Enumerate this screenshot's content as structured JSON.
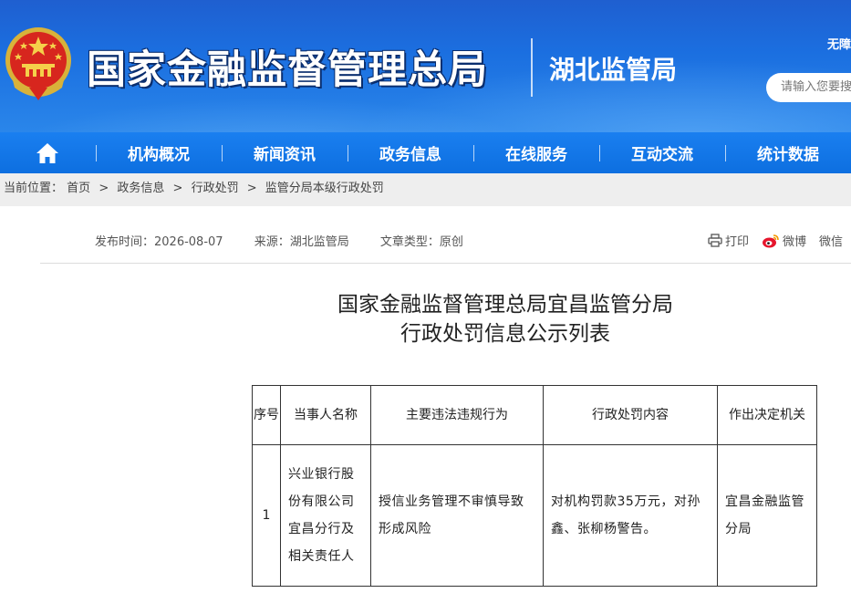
{
  "header": {
    "site_title": "国家金融监督管理总局",
    "sub_title": "湖北监管局",
    "access_link": "无障",
    "search_placeholder": "请输入您要搜"
  },
  "nav": {
    "home_icon": "home-icon",
    "items": [
      "机构概况",
      "新闻资讯",
      "政务信息",
      "在线服务",
      "互动交流",
      "统计数据"
    ]
  },
  "breadcrumb": {
    "label": "当前位置：",
    "items": [
      "首页",
      "政务信息",
      "行政处罚",
      "监管分局本级行政处罚"
    ],
    "separator": ">"
  },
  "meta": {
    "publish_time": "发布时间：2026-08-07",
    "source": "来源：湖北监管局",
    "article_type": "文章类型：原创"
  },
  "share": {
    "print": "打印",
    "weibo": "微博",
    "wechat": "微信"
  },
  "document": {
    "title_line1": "国家金融监督管理总局宜昌监管分局",
    "title_line2": "行政处罚信息公示列表"
  },
  "table": {
    "headers": [
      "序号",
      "当事人名称",
      "主要违法违规行为",
      "行政处罚内容",
      "作出决定机关"
    ],
    "rows": [
      {
        "no": "1",
        "party": "兴业银行股份有限公司宜昌分行及相关责任人",
        "violation": "授信业务管理不审慎导致形成风险",
        "penalty": "对机构罚款35万元，对孙鑫、张柳杨警告。",
        "authority": "宜昌金融监管分局"
      }
    ]
  },
  "colors": {
    "header_blue": "#1b6fe0",
    "nav_blue": "#0d6fe0",
    "breadcrumb_bg": "#eeeeee"
  }
}
